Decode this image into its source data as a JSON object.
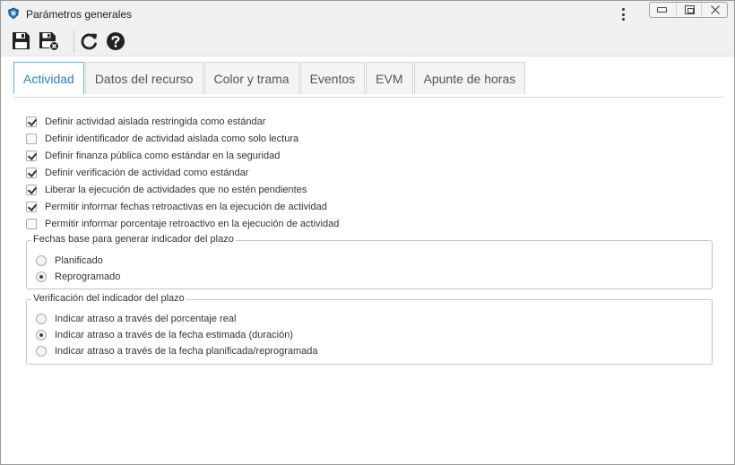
{
  "window": {
    "title": "Parámetros generales",
    "icons": {
      "app": "app-shield-icon",
      "menu": "more-vertical-icon",
      "minimize": "minimize-icon",
      "maximize": "restore-icon",
      "close": "close-icon"
    }
  },
  "toolbar": {
    "buttons": [
      {
        "name": "save",
        "icon": "save-icon"
      },
      {
        "name": "save-and-close",
        "icon": "save-close-icon"
      },
      {
        "name": "refresh",
        "icon": "refresh-icon"
      },
      {
        "name": "help",
        "icon": "help-icon"
      }
    ]
  },
  "tabs": [
    {
      "label": "Actividad",
      "active": true
    },
    {
      "label": "Datos del recurso",
      "active": false
    },
    {
      "label": "Color y trama",
      "active": false
    },
    {
      "label": "Eventos",
      "active": false
    },
    {
      "label": "EVM",
      "active": false
    },
    {
      "label": "Apunte de horas",
      "active": false
    }
  ],
  "options": [
    {
      "label": "Definir actividad aislada restringida como estándar",
      "checked": true
    },
    {
      "label": "Definir identificador de actividad aislada como solo lectura",
      "checked": false
    },
    {
      "label": "Definir finanza pública como estándar en la seguridad",
      "checked": true
    },
    {
      "label": "Definir verificación de actividad como estándar",
      "checked": true
    },
    {
      "label": "Liberar la ejecución de actividades que no estén pendientes",
      "checked": true
    },
    {
      "label": "Permitir informar fechas retroactivas en la ejecución de actividad",
      "checked": true
    },
    {
      "label": "Permitir informar porcentaje retroactivo en la ejecución de actividad",
      "checked": false
    }
  ],
  "groups": {
    "base_dates": {
      "legend": "Fechas base para generar indicador del plazo",
      "options": [
        {
          "label": "Planificado",
          "selected": false
        },
        {
          "label": "Reprogramado",
          "selected": true
        }
      ]
    },
    "indicator_check": {
      "legend": "Verificación del indicador del plazo",
      "options": [
        {
          "label": "Indicar atraso a través del porcentaje real",
          "selected": false
        },
        {
          "label": "Indicar atraso a través de la fecha estimada (duración)",
          "selected": true
        },
        {
          "label": "Indicar atraso a través de la fecha planificada/reprogramada",
          "selected": false
        }
      ]
    }
  },
  "colors": {
    "accent": "#2a7fc0",
    "tab_active_border": "#6fa8dc",
    "chrome": "#f0f0f0"
  }
}
